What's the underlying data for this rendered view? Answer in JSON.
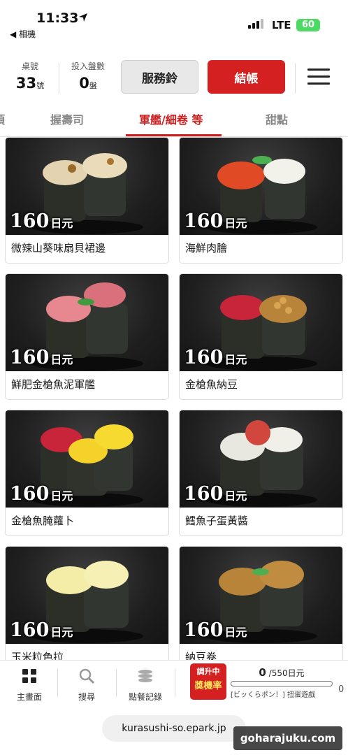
{
  "status": {
    "time": "11:33",
    "back": "◀ 相機",
    "network": "LTE",
    "battery": "60"
  },
  "header": {
    "table_label": "桌號",
    "table_value": "33",
    "table_unit": "號",
    "plates_label": "投入盤數",
    "plates_value": "0",
    "plates_unit": "盤",
    "bell_label": "服務鈴",
    "pay_label": "結帳"
  },
  "tabs": [
    "頂",
    "握壽司",
    "軍艦/細卷 等",
    "甜點"
  ],
  "price_unit": "日元",
  "items": [
    {
      "name": "微辣山葵味扇貝裙邊",
      "price": "160"
    },
    {
      "name": "海鮮肉膾",
      "price": "160"
    },
    {
      "name": "鮮肥金槍魚泥軍艦",
      "price": "160"
    },
    {
      "name": "金槍魚納豆",
      "price": "160"
    },
    {
      "name": "金槍魚腌蘿卜",
      "price": "160"
    },
    {
      "name": "鱈魚子蛋黃醬",
      "price": "160"
    },
    {
      "name": "玉米粒色拉",
      "price": "160"
    },
    {
      "name": "納豆卷",
      "price": "160"
    }
  ],
  "bottom": {
    "home": "主畫面",
    "search": "搜尋",
    "history": "點餐記錄",
    "gacha_top": "調升中",
    "gacha_main": "獎機率",
    "progress_value": "0",
    "progress_total": "/550日元",
    "progress_label": "[ビッくらポン！] 扭蛋遊戲",
    "progress_fraction": 0,
    "trailing": "0"
  },
  "url": "kurasushi-so.epark.jp",
  "watermark": "goharajuku.com",
  "colors": {
    "accent": "#d42020",
    "battery": "#4cd964"
  }
}
